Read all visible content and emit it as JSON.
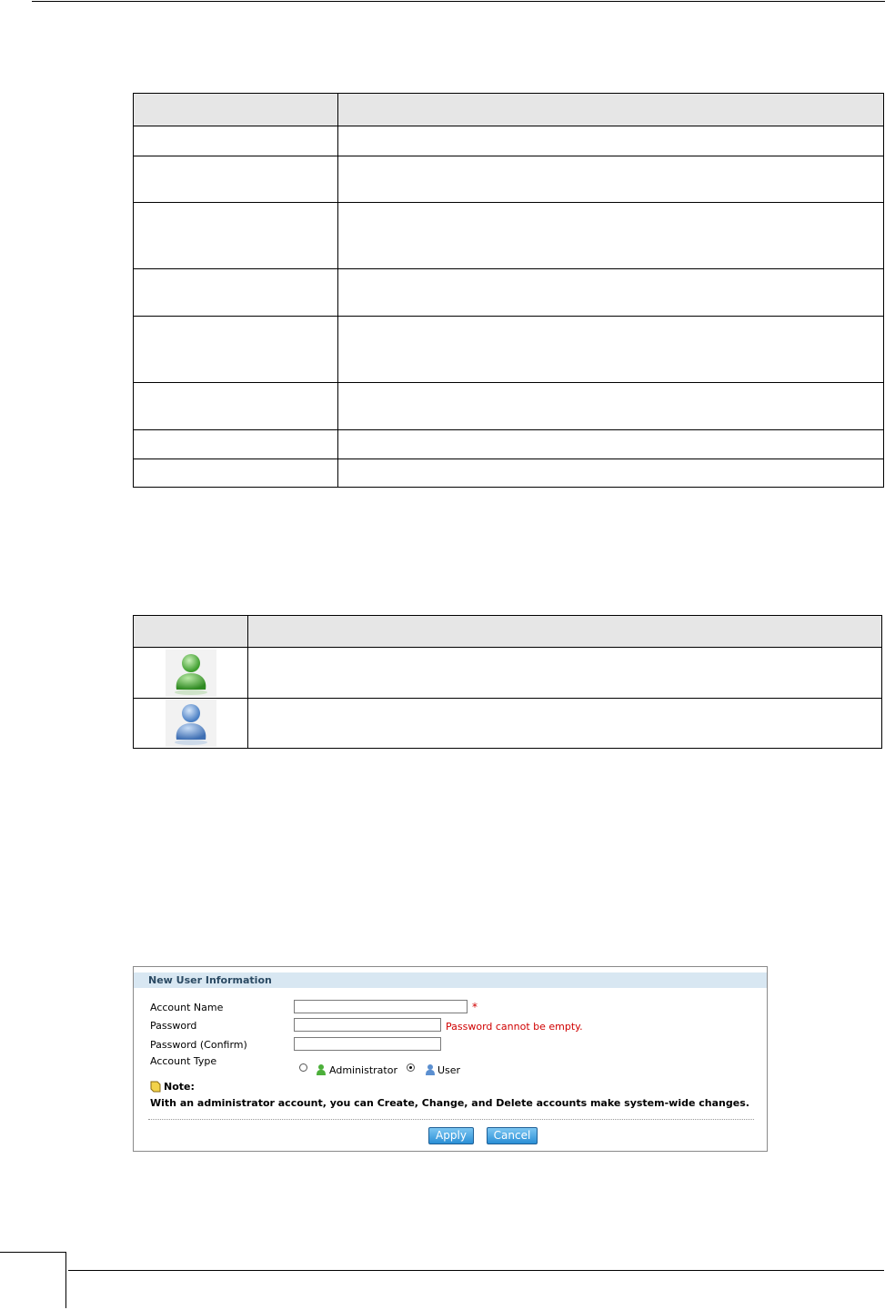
{
  "table1": {
    "rows": [
      {
        "c1": "",
        "c2": ""
      },
      {
        "c1": "",
        "c2": ""
      },
      {
        "c1": "",
        "c2": ""
      },
      {
        "c1": "",
        "c2": ""
      },
      {
        "c1": "",
        "c2": ""
      },
      {
        "c1": "",
        "c2": ""
      },
      {
        "c1": "",
        "c2": ""
      },
      {
        "c1": "",
        "c2": ""
      },
      {
        "c1": "",
        "c2": ""
      }
    ]
  },
  "table2": {
    "rows": [
      {
        "icon": "administrator-user-icon",
        "color": "#4caf3a",
        "desc": ""
      },
      {
        "icon": "user-icon",
        "color": "#5b8fd0",
        "desc": ""
      }
    ]
  },
  "dialog": {
    "title": "New User Information",
    "account_name_label": "Account Name",
    "account_name_value": "",
    "required_marker": "*",
    "password_label": "Password",
    "password_value": "",
    "password_error": "Password cannot be empty.",
    "password_confirm_label": "Password (Confirm)",
    "password_confirm_value": "",
    "account_type_label": "Account Type",
    "account_type_options": [
      {
        "label": "Administrator",
        "selected": false,
        "icon": "administrator-icon"
      },
      {
        "label": "User",
        "selected": true,
        "icon": "user-icon"
      }
    ],
    "note_label": "Note:",
    "note_text": "With an administrator account, you can Create, Change, and Delete accounts make system-wide changes.",
    "apply_label": "Apply",
    "cancel_label": "Cancel"
  },
  "colors": {
    "error": "#d00000",
    "title_bar": "#d8e7f2",
    "button": "#2a8fd6",
    "admin_icon": "#4caf3a",
    "user_icon": "#5b8fd0"
  }
}
